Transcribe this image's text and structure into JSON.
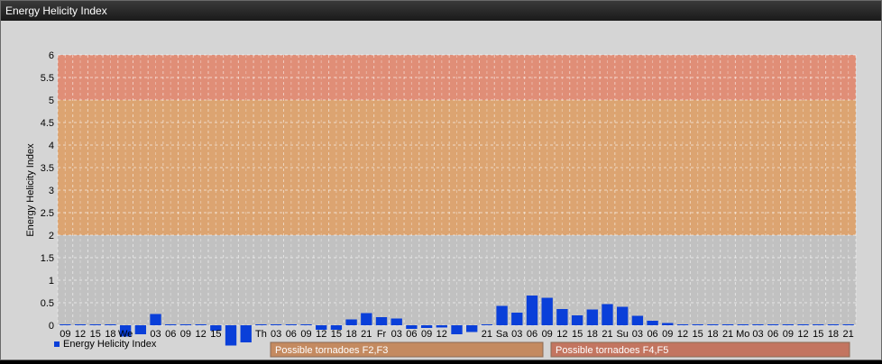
{
  "window": {
    "title": "Energy Helicity Index"
  },
  "chart_data": {
    "type": "bar",
    "title": "",
    "ylabel": "Energy Helicity Index",
    "ylim": [
      0,
      6
    ],
    "yticks": [
      "0",
      "0.5",
      "1",
      "1.5",
      "2",
      "2.5",
      "3",
      "3.5",
      "4",
      "4.5",
      "5",
      "5.5",
      "6"
    ],
    "bands": [
      {
        "from": 0,
        "to": 2,
        "color": "#c0c0c0"
      },
      {
        "from": 2,
        "to": 5,
        "color": "#dca16c"
      },
      {
        "from": 5,
        "to": 6,
        "color": "#e08a72"
      }
    ],
    "categories": [
      "09",
      "12",
      "15",
      "18",
      "We",
      "",
      "03",
      "06",
      "09",
      "12",
      "15",
      "",
      "",
      "Th",
      "03",
      "06",
      "09",
      "12",
      "15",
      "18",
      "21",
      "Fr",
      "03",
      "06",
      "09",
      "12",
      "",
      "",
      "21",
      "Sa",
      "03",
      "06",
      "09",
      "12",
      "15",
      "18",
      "21",
      "Su",
      "03",
      "06",
      "09",
      "12",
      "15",
      "18",
      "21",
      "Mo",
      "03",
      "06",
      "09",
      "12",
      "15",
      "18",
      "21"
    ],
    "series": [
      {
        "name": "Energy Helicity Index",
        "color": "#0a3fd9",
        "values": [
          0.02,
          0.02,
          0.02,
          0.02,
          -0.25,
          -0.2,
          0.25,
          0.02,
          0.02,
          0.02,
          -0.12,
          -0.45,
          -0.38,
          0.02,
          0.02,
          0.02,
          0.02,
          -0.1,
          -0.1,
          0.13,
          0.27,
          0.18,
          0.15,
          -0.08,
          -0.06,
          -0.05,
          -0.2,
          -0.15,
          0.02,
          0.43,
          0.28,
          0.66,
          0.61,
          0.36,
          0.22,
          0.35,
          0.47,
          0.41,
          0.21,
          0.1,
          0.05,
          0.02,
          0.02,
          0.02,
          0.02,
          0.02,
          0.02,
          0.02,
          0.02,
          0.02,
          0.02,
          0.02,
          0.02
        ]
      }
    ],
    "legend": [
      {
        "label": "Energy Helicity Index",
        "color": "#0a3fd9"
      }
    ],
    "annotations": [
      {
        "label": "Possible tornadoes F2,F3",
        "color": "#c48a60"
      },
      {
        "label": "Possible tornadoes F4,F5",
        "color": "#c37560"
      }
    ]
  }
}
